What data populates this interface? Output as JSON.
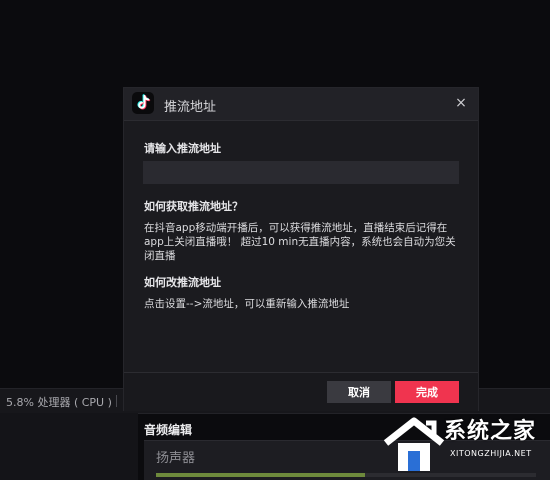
{
  "status_bar": {
    "cpu_text": "5.8% 处理器 ( CPU )"
  },
  "audio": {
    "title": "音频编辑",
    "speaker_label": "扬声器",
    "meter_level": 0.55
  },
  "dialog": {
    "title": "推流地址",
    "close_glyph": "×",
    "field_label": "请输入推流地址",
    "input_value": "",
    "input_placeholder": "",
    "howto_heading": "如何获取推流地址？",
    "howto_body": "在抖音app移动端开播后，可以获得推流地址，直播结束后记得在app上关闭直播哦！ 超过10 min无直播内容，系统也会自动为您关闭直播",
    "change_heading": "如何改推流地址",
    "change_body": "点击设置-->流地址，可以重新输入推流地址",
    "cancel_label": "取消",
    "done_label": "完成"
  },
  "watermark": {
    "main": "系统之家",
    "sub": "XITONGZHIJIA.NET"
  },
  "colors": {
    "accent": "#f0344f",
    "dialog_bg": "#1b1b1f",
    "page_bg": "#0b0b0e"
  },
  "icons": {
    "app_logo": "tiktok-logo-icon",
    "close": "close-icon",
    "watermark_logo": "house-logo-icon"
  }
}
